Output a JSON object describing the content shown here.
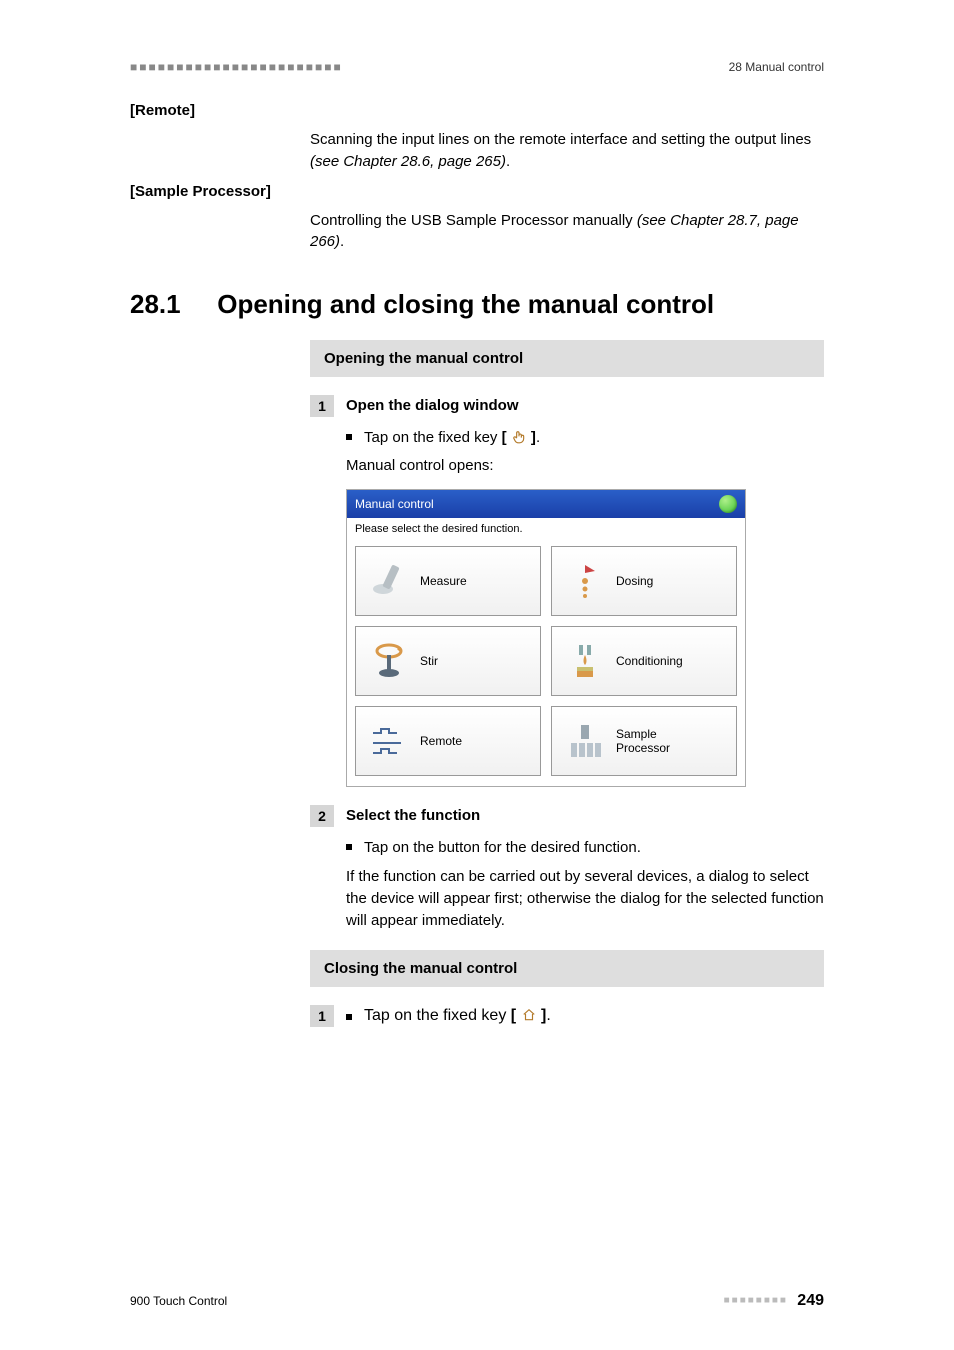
{
  "header": {
    "left_decor": "■■■■■■■■■■■■■■■■■■■■■■■",
    "right": "28 Manual control"
  },
  "defs": {
    "remote": {
      "term": "[Remote]",
      "body_a": "Scanning the input lines on the remote interface and setting the output lines ",
      "body_b": "(see Chapter 28.6, page 265)",
      "body_c": "."
    },
    "sample_processor": {
      "term": "[Sample Processor]",
      "body_a": "Controlling the USB Sample Processor manually ",
      "body_b": "(see Chapter 28.7, page 266)",
      "body_c": "."
    }
  },
  "chapter": {
    "num": "28.1",
    "title": "Opening and closing the manual control"
  },
  "band_open": "Opening the manual control",
  "step1": {
    "num": "1",
    "title": "Open the dialog window",
    "bullet_a": "Tap on the fixed key ",
    "bullet_b": "[ ",
    "bullet_c": " ]",
    "bullet_d": ".",
    "after": "Manual control opens:"
  },
  "screenshot": {
    "title": "Manual control",
    "hint": "Please select the desired function.",
    "tiles": {
      "measure": "Measure",
      "dosing": "Dosing",
      "stir": "Stir",
      "conditioning": "Conditioning",
      "remote": "Remote",
      "sample_processor": "Sample\nProcessor"
    }
  },
  "step2": {
    "num": "2",
    "title": "Select the function",
    "bullet": "Tap on the button for the desired function.",
    "after": "If the function can be carried out by several devices, a dialog to select the device will appear first; otherwise the dialog for the selected function will appear immediately."
  },
  "band_close": "Closing the manual control",
  "step3": {
    "num": "1",
    "bullet_a": "Tap on the fixed key ",
    "bullet_b": "[ ",
    "bullet_c": " ]",
    "bullet_d": "."
  },
  "footer": {
    "left": "900 Touch Control",
    "squares": "■■■■■■■■",
    "page": "249"
  }
}
